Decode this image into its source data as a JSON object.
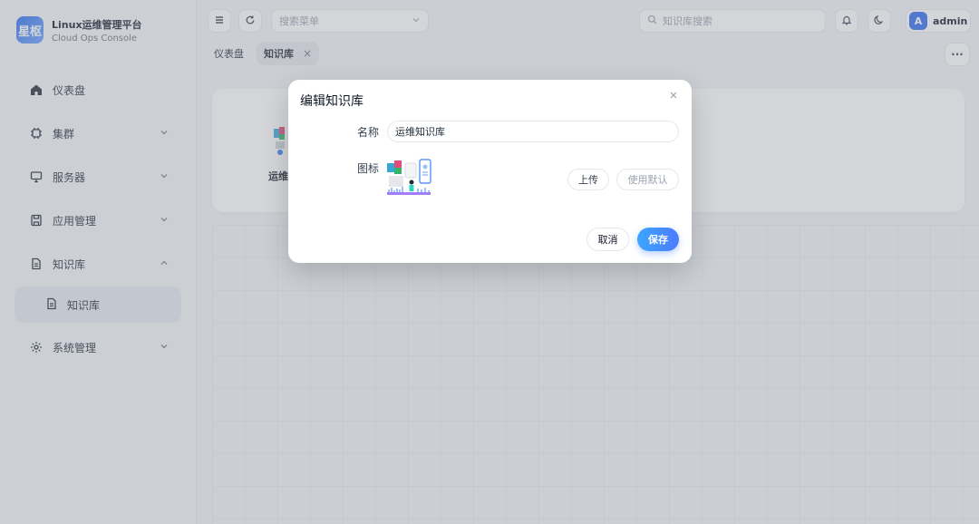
{
  "brand": {
    "logo_text": "星枢",
    "title": "Linux运维管理平台",
    "subtitle": "Cloud Ops Console"
  },
  "sidebar": {
    "items": [
      {
        "label": "仪表盘",
        "icon": "home-icon"
      },
      {
        "label": "集群",
        "icon": "chip-icon"
      },
      {
        "label": "服务器",
        "icon": "monitor-icon"
      },
      {
        "label": "应用管理",
        "icon": "save-icon"
      },
      {
        "label": "知识库",
        "icon": "document-icon"
      },
      {
        "label": "系统管理",
        "icon": "gear-icon"
      }
    ],
    "sub_item": {
      "label": "知识库",
      "icon": "document-icon"
    }
  },
  "topbar": {
    "menu_search_placeholder": "搜索菜单",
    "kb_search_placeholder": "知识库搜索",
    "user_initial": "A",
    "user_name": "admin"
  },
  "tabs": [
    {
      "label": "仪表盘",
      "active": false
    },
    {
      "label": "知识库",
      "active": true,
      "close": "×"
    }
  ],
  "more_label": "···",
  "main": {
    "kb_card_label": "运维"
  },
  "modal": {
    "title": "编辑知识库",
    "name_label": "名称",
    "name_value": "运维知识库",
    "icon_label": "图标",
    "upload_label": "上传",
    "default_label": "使用默认",
    "cancel_label": "取消",
    "save_label": "保存"
  },
  "colors": {
    "accent": "#3f7cff",
    "avatar": "#2f6bf0",
    "sidebar_active": "#e6ebf3"
  }
}
